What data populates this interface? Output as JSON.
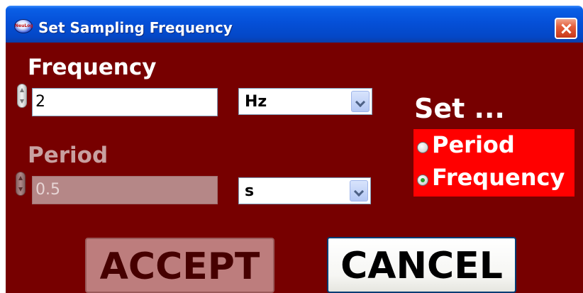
{
  "window": {
    "title": "Set Sampling Frequency",
    "app_icon_text": "NeuLog"
  },
  "frequency": {
    "label": "Frequency",
    "value": "2",
    "unit": "Hz"
  },
  "period": {
    "label": "Period",
    "value": "0.5",
    "unit": "s",
    "enabled": false
  },
  "set_group": {
    "title": "Set ...",
    "options": [
      {
        "label": "Period",
        "checked": false
      },
      {
        "label": "Frequency",
        "checked": true
      }
    ]
  },
  "buttons": {
    "accept_label": "ACCEPT",
    "cancel_label": "CANCEL"
  },
  "colors": {
    "dialog_background": "#770000",
    "titlebar_blue": "#0550d8",
    "radio_group_background": "#ff0000",
    "disabled_text": "#c8a0a0",
    "accept_button": "#bd7d7d"
  }
}
